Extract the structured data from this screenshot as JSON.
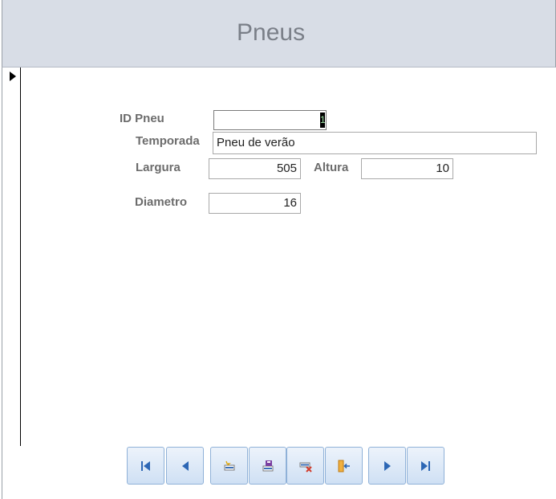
{
  "form": {
    "title": "Pneus"
  },
  "fields": {
    "id_pneu": {
      "label": "ID Pneu",
      "value": "1"
    },
    "temporada": {
      "label": "Temporada",
      "value": "Pneu de verão"
    },
    "largura": {
      "label": "Largura",
      "value": "505"
    },
    "altura": {
      "label": "Altura",
      "value": "10"
    },
    "diametro": {
      "label": "Diametro",
      "value": "16"
    }
  },
  "navigation": {
    "buttons": [
      {
        "name": "first-record-button",
        "icon": "first-record-icon"
      },
      {
        "name": "previous-record-button",
        "icon": "previous-record-icon"
      },
      {
        "name": "new-record-button",
        "icon": "new-record-icon"
      },
      {
        "name": "save-record-button",
        "icon": "save-icon"
      },
      {
        "name": "delete-record-button",
        "icon": "delete-record-icon"
      },
      {
        "name": "close-form-button",
        "icon": "exit-icon"
      },
      {
        "name": "next-record-button",
        "icon": "next-record-icon"
      },
      {
        "name": "last-record-button",
        "icon": "last-record-icon"
      }
    ],
    "accent_color": "#2d67b5",
    "button_border_color": "#8fb1d8"
  },
  "colors": {
    "header_bg": "#d8dde6",
    "title_color": "#7a7f88",
    "label_color": "#6c6c6c"
  }
}
